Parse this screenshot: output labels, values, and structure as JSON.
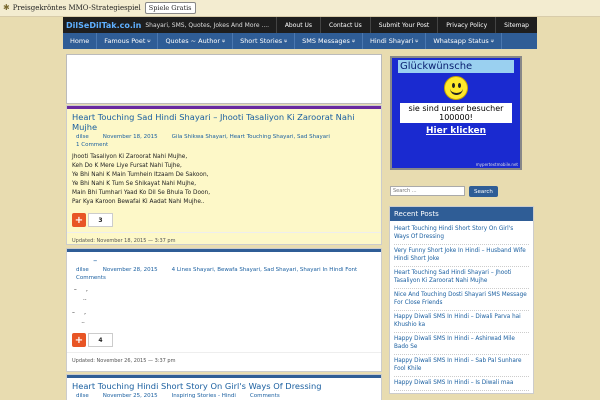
{
  "ad": {
    "text": "Preisgekröntes MMO-Strategiespiel",
    "button": "Spiele Gratis"
  },
  "header": {
    "logo": "DilSeDilTak.co.in",
    "tagline": "Shayari, SMS, Quotes, Jokes And More ....",
    "topnav": [
      "About Us",
      "Contact Us",
      "Submit Your Post",
      "Privacy Policy",
      "Sitemap"
    ]
  },
  "mainnav": [
    {
      "label": "Home",
      "caret": ""
    },
    {
      "label": "Famous Poet",
      "caret": "⍦"
    },
    {
      "label": "Quotes ~ Author",
      "caret": "⍦"
    },
    {
      "label": "Short Stories",
      "caret": "⍦"
    },
    {
      "label": "SMS Messages",
      "caret": "⍦"
    },
    {
      "label": "Hindi Shayari",
      "caret": "⍦"
    },
    {
      "label": "Whatsapp Status",
      "caret": "⍦"
    }
  ],
  "posts": [
    {
      "title": "Heart Touching Sad Hindi Shayari – Jhooti Tasaliyon Ki Zaroorat Nahi Mujhe",
      "author": "dilse",
      "date": "November 18, 2015",
      "cats": "Gila Shikwa Shayari, Heart Touching Shayari, Sad Shayari",
      "comments": "1 Comment",
      "lines": [
        "Jhooti Tasaliyon Ki Zaroorat Nahi Mujhe,",
        "Keh Do K Mere Liye Fursat Nahi Tujhe,",
        "Ye Bhi Nahi K Main Tumhein Itzaam De Sakoon,",
        "Ye Bhi Nahi K Tum Se Shikayat Nahi Mujhe,",
        "Main Bhi Tumhari Yaad Ko Dil Se Bhula To Doon,",
        "Par Kya Karoon Bewafai Ki Aadat Nahi Mujhe.."
      ],
      "count": "3",
      "updated": "Updated: November 18, 2015 — 3:37 pm"
    },
    {
      "title": "‪‪‪‪‪‪‪‪‪‪‪‪ ‪‪‪‪‪ ‪‪ ‪‪‪‪ ‪‪ ‪‪‪‪ ‪‪‪‪‪‪ ‪‪‪‪ – ‪‪‪‪‪ ‪‪‪‪ ‪‪‪ ‪‪‪ ‪‪‪‪",
      "author": "dilse",
      "date": "November 28, 2015",
      "cats": "4 Lines Shayari, Bewafa Shayari, Sad Shayari, Shayari In Hindi Font",
      "comments": "Comments",
      "lines": [
        "‪‪‪‪‪‪‪‪‪‪‪‪ – ‪‪‪‪ ‪‪‪‪‪ ‪‪‪‪ ‪‪‪ ‪‪‪‪,",
        "‪‪‪‪ ‪‪‪ ‪‪‪‪ ‪‪ ‪‪‪ ‪‪ ‪‪‪‪‪..",
        "",
        "‪‪‪‪‪‪‪‪– ‪‪‪‪ ‪‪‪‪‪‪‪ ‪‪‪‪‪‪‪ ‪‪‪ ‪‪‪‪‪,",
        "‪‪‪ ‪‪ ‪‪‪‪‪‪‪ ‪‪‪‪‪‪‪ ‪‪‪ ‪‪‪‪‪.."
      ],
      "count": "4",
      "updated": "Updated: November 26, 2015 — 3:37 pm"
    },
    {
      "title": "Heart Touching Hindi Short Story On Girl's Ways Of Dressing",
      "author": "dilse",
      "date": "November 25, 2015",
      "cats": "Inspiring Stories - Hindi",
      "comments": "Comments"
    }
  ],
  "banner": {
    "title": "Glückwünsche",
    "message": "sie sind unser besucher 100000!",
    "link": "Hier klicken",
    "url": "mypertextmobile.net"
  },
  "search": {
    "placeholder": "Search ...",
    "button": "Search"
  },
  "recent": {
    "title": "Recent Posts",
    "items": [
      "Heart Touching Hindi Short Story On Girl's Ways Of Dressing",
      "Very Funny Short Joke In Hindi – Husband Wife Hindi Short Joke",
      "Heart Touching Sad Hindi Shayari – Jhooti Tasaliyon Ki Zaroorat Nahi Mujhe",
      "Nice And Touching Dosti Shayari SMS Message For Close Friends",
      "Happy Diwali SMS In Hindi – Diwali Parva hai Khushio ka",
      "Happy Diwali SMS In Hindi – Ashirwad Mile Bado Se",
      "Happy Diwali SMS In Hindi – Sab Pal Sunhare Fool Khile",
      "Happy Diwali SMS In Hindi – Is Diwali maa"
    ]
  }
}
